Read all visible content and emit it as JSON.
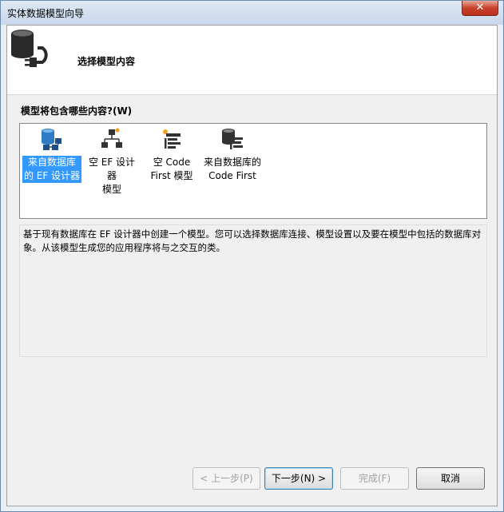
{
  "window": {
    "title": "实体数据模型向导",
    "close_glyph": "✕"
  },
  "header": {
    "title": "选择模型内容",
    "icon": "database-plug-icon"
  },
  "content_prompt": "模型将包含哪些内容?(W)",
  "options": [
    {
      "label": "来自数据库\n的 EF 设计器",
      "icon": "database-diagram-icon",
      "selected": true
    },
    {
      "label": "空 EF 设计器\n模型",
      "icon": "hierarchy-icon",
      "selected": false
    },
    {
      "label": "空 Code\nFirst 模型",
      "icon": "code-first-icon",
      "selected": false
    },
    {
      "label": "来自数据库的\nCode First",
      "icon": "database-code-icon",
      "selected": false
    }
  ],
  "description": "基于现有数据库在 EF 设计器中创建一个模型。您可以选择数据库连接、模型设置以及要在模型中包括的数据库对象。从该模型生成您的应用程序将与之交互的类。",
  "buttons": {
    "back": "< 上一步(P)",
    "next": "下一步(N) >",
    "finish": "完成(F)",
    "cancel": "取消"
  },
  "colors": {
    "selection": "#3399ff",
    "close": "#c8412c"
  }
}
